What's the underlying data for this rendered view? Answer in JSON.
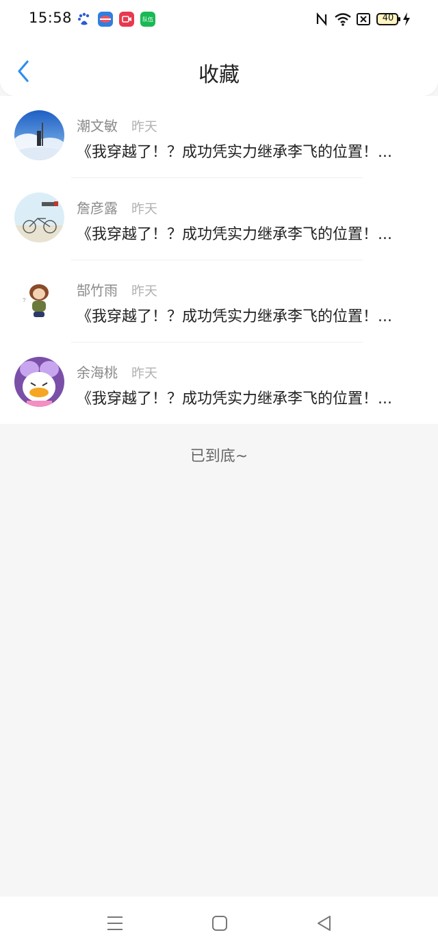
{
  "status_bar": {
    "time": "15:58",
    "app_icons": [
      "baidu-icon",
      "browser-icon",
      "video-icon",
      "team-app-icon"
    ],
    "team_app_label": "队伍",
    "battery": "40"
  },
  "header": {
    "title": "收藏"
  },
  "favorites": [
    {
      "name": "潮文敏",
      "time": "昨天",
      "text": "《我穿越了！？成功凭实力继承李飞的位置！..."
    },
    {
      "name": "詹彦露",
      "time": "昨天",
      "text": "《我穿越了！？成功凭实力继承李飞的位置！..."
    },
    {
      "name": "郜竹雨",
      "time": "昨天",
      "text": "《我穿越了！？成功凭实力继承李飞的位置！..."
    },
    {
      "name": "余海桃",
      "time": "昨天",
      "text": "《我穿越了！？成功凭实力继承李飞的位置！..."
    }
  ],
  "end_text": "已到底~",
  "colors": {
    "accent": "#2a8ff0",
    "background": "#f7f6f7",
    "name_text": "#8a8a8a",
    "time_text": "#b2b2b2"
  }
}
